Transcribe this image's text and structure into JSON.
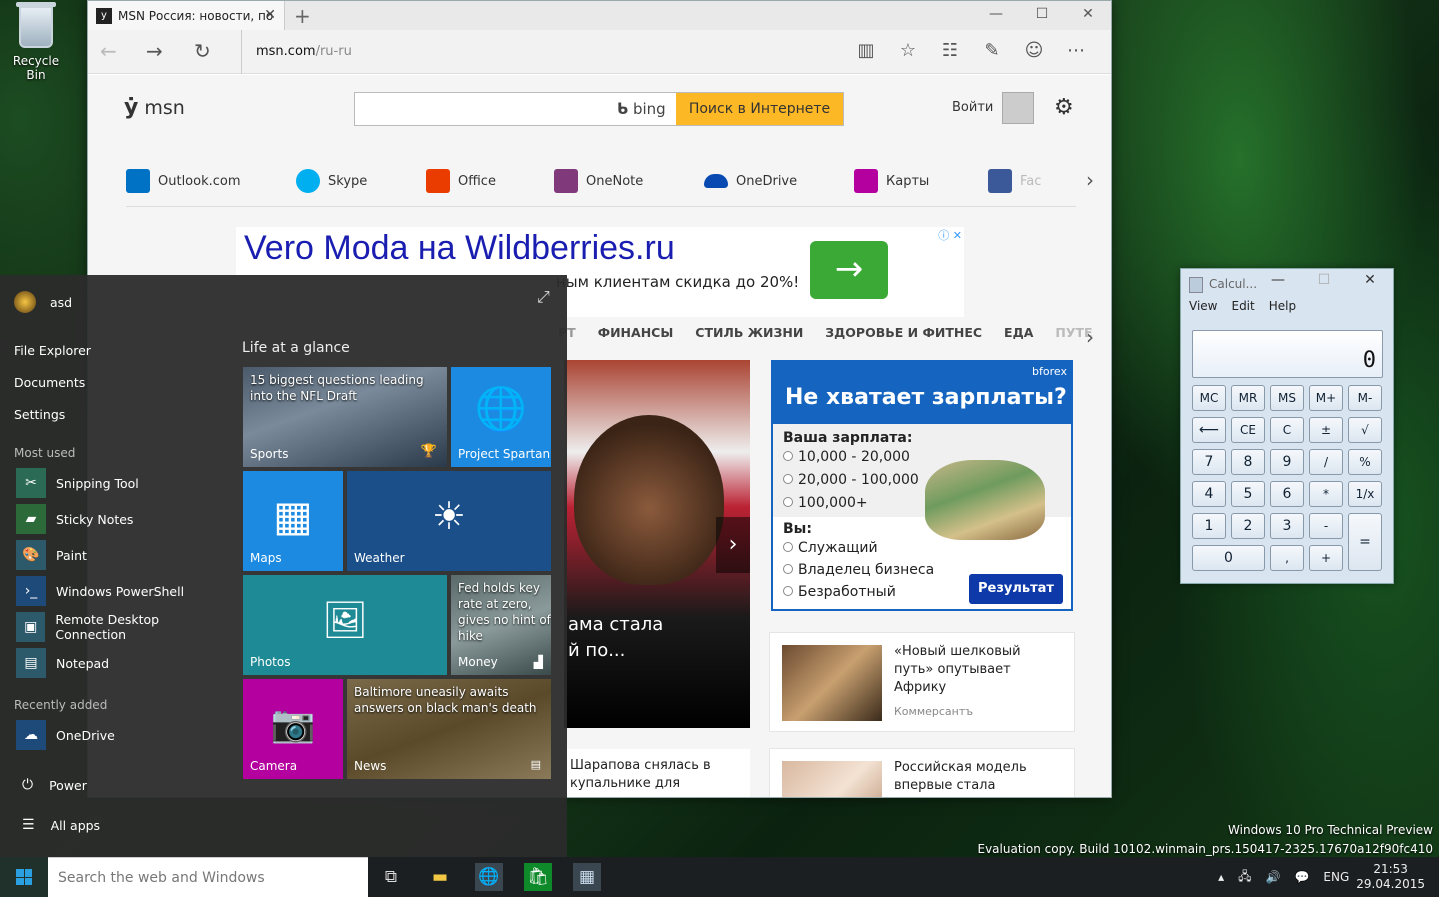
{
  "desktop": {
    "recycle_bin_label": "Recycle Bin",
    "watermark_line1": "Windows 10 Pro Technical Preview",
    "watermark_line2": "Evaluation copy. Build 10102.winmain_prs.150417-2325.17670a12f90fc410"
  },
  "browser": {
    "tab_title": "MSN Россия: новости, по",
    "url_host": "msn.com",
    "url_path": "/ru-ru",
    "msn": {
      "logo": "msn",
      "bing_label": "bing",
      "search_button": "Поиск в Интернете",
      "login": "Войти",
      "links": [
        {
          "label": "Outlook.com",
          "color": "#0072c6"
        },
        {
          "label": "Skype",
          "color": "#00aff0"
        },
        {
          "label": "Office",
          "color": "#eb3c00"
        },
        {
          "label": "OneNote",
          "color": "#80397b"
        },
        {
          "label": "OneDrive",
          "color": "#094ab2"
        },
        {
          "label": "Карты",
          "color": "#b4009e"
        },
        {
          "label": "Fac",
          "color": "#3b5998"
        }
      ],
      "ad_title": "Vero Moda на Wildberries.ru",
      "ad_sub": "ным клиентам скидка до 20%!",
      "categories": [
        "РТ",
        "ФИНАНСЫ",
        "СТИЛЬ ЖИЗНИ",
        "ЗДОРОВЬЕ И ФИТНЕС",
        "ЕДА",
        "ПУТЕ"
      ],
      "hero_caption": "ама стала\nй по...",
      "bforex": {
        "brand": "bforex",
        "headline": "Не хватает зарплаты?",
        "salary_label": "Ваша зарплата:",
        "salary_options": [
          "10,000 - 20,000",
          "20,000 - 100,000",
          "100,000+"
        ],
        "you_label": "Вы:",
        "you_options": [
          "Служащий",
          "Владелец бизнеса",
          "Безработный"
        ],
        "result_button": "Результат"
      },
      "card1": {
        "title": "«Новый шелковый путь» опутывает Африку",
        "source": "Коммерсантъ"
      },
      "card2": {
        "title": "Российская модель впервые стала «ангелом»"
      },
      "news_bottom": "Шарапова снялась в купальнике для"
    }
  },
  "start": {
    "user": "asd",
    "places": [
      "File Explorer",
      "Documents",
      "Settings"
    ],
    "most_used_label": "Most used",
    "most_used": [
      "Snipping Tool",
      "Sticky Notes",
      "Paint",
      "Windows PowerShell",
      "Remote Desktop Connection",
      "Notepad"
    ],
    "recently_added_label": "Recently added",
    "recently_added": [
      "OneDrive"
    ],
    "power": "Power",
    "all_apps": "All apps",
    "tiles_header": "Life at a glance",
    "tiles": {
      "sports": {
        "label": "Sports",
        "text": "15 biggest questions leading into the NFL Draft"
      },
      "spartan": {
        "label": "Project Spartan"
      },
      "maps": {
        "label": "Maps"
      },
      "weather": {
        "label": "Weather"
      },
      "photos": {
        "label": "Photos"
      },
      "money": {
        "label": "Money",
        "text": "Fed holds key rate at zero, gives no hint of hike"
      },
      "camera": {
        "label": "Camera"
      },
      "news": {
        "label": "News",
        "text": "Baltimore uneasily awaits answers on black man's death"
      }
    }
  },
  "calculator": {
    "title": "Calcul...",
    "menu": [
      "View",
      "Edit",
      "Help"
    ],
    "display": "0",
    "rows": [
      [
        "MC",
        "MR",
        "MS",
        "M+",
        "M-"
      ],
      [
        "⟵",
        "CE",
        "C",
        "±",
        "√"
      ],
      [
        "7",
        "8",
        "9",
        "/",
        "%"
      ],
      [
        "4",
        "5",
        "6",
        "*",
        "1/x"
      ],
      [
        "1",
        "2",
        "3",
        "-",
        "="
      ],
      [
        "0",
        ",",
        "+"
      ]
    ]
  },
  "taskbar": {
    "search_placeholder": "Search the web and Windows",
    "lang": "ENG",
    "time": "21:53",
    "date": "29.04.2015"
  }
}
